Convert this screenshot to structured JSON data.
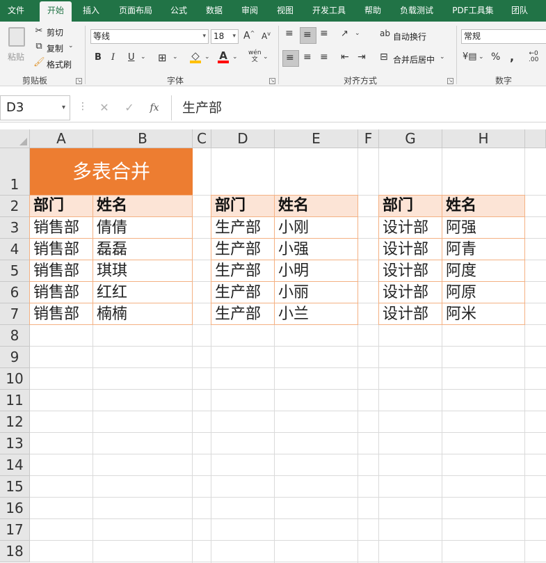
{
  "menu": [
    "文件",
    "开始",
    "插入",
    "页面布局",
    "公式",
    "数据",
    "审阅",
    "视图",
    "开发工具",
    "帮助",
    "负载测试",
    "PDF工具集",
    "团队"
  ],
  "active_menu": "开始",
  "ribbon": {
    "clipboard": {
      "paste": "粘贴",
      "cut": "剪切",
      "copy": "复制",
      "format_painter": "格式刷",
      "label": "剪贴板"
    },
    "font": {
      "name": "等线",
      "size": "18",
      "bold": "B",
      "italic": "I",
      "underline": "U",
      "label": "字体",
      "grow": "A",
      "shrink": "A",
      "phonetic": "wén"
    },
    "alignment": {
      "wrap": "自动换行",
      "merge": "合并后居中",
      "label": "对齐方式"
    },
    "number": {
      "format": "常规",
      "percent": "%",
      "comma": ",",
      "label": "数字"
    }
  },
  "formula_bar": {
    "cell_ref": "D3",
    "cancel": "✕",
    "enter": "✓",
    "fx": "fx",
    "value": "生产部"
  },
  "columns": [
    "A",
    "B",
    "C",
    "D",
    "E",
    "F",
    "G",
    "H"
  ],
  "rows": [
    "1",
    "2",
    "3",
    "4",
    "5",
    "6",
    "7",
    "8",
    "9",
    "10",
    "11",
    "12",
    "13",
    "14",
    "15",
    "16",
    "17",
    "18"
  ],
  "title": "多表合并",
  "tables": [
    {
      "headers": [
        "部门",
        "姓名"
      ],
      "rows": [
        [
          "销售部",
          "倩倩"
        ],
        [
          "销售部",
          "磊磊"
        ],
        [
          "销售部",
          "琪琪"
        ],
        [
          "销售部",
          "红红"
        ],
        [
          "销售部",
          "楠楠"
        ]
      ]
    },
    {
      "headers": [
        "部门",
        "姓名"
      ],
      "rows": [
        [
          "生产部",
          "小刚"
        ],
        [
          "生产部",
          "小强"
        ],
        [
          "生产部",
          "小明"
        ],
        [
          "生产部",
          "小丽"
        ],
        [
          "生产部",
          "小兰"
        ]
      ]
    },
    {
      "headers": [
        "部门",
        "姓名"
      ],
      "rows": [
        [
          "设计部",
          "阿强"
        ],
        [
          "设计部",
          "阿青"
        ],
        [
          "设计部",
          "阿度"
        ],
        [
          "设计部",
          "阿原"
        ],
        [
          "设计部",
          "阿米"
        ]
      ]
    }
  ],
  "colors": {
    "accent": "#217346",
    "title_fill": "#ed7d31",
    "header_fill": "#fce4d6",
    "border": "#f4b183"
  }
}
